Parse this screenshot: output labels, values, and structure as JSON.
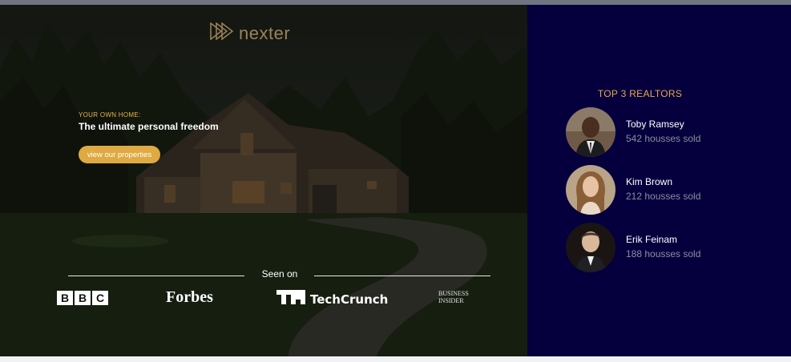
{
  "hero": {
    "logo": {
      "text": "nexter",
      "icon": "play-triangles-icon"
    },
    "tagline": "YOUR OWN HOME:",
    "headline": "The ultimate personal freedom",
    "cta_label": "view our properties"
  },
  "seen_on": {
    "label": "Seen on",
    "brands": {
      "bbc": [
        "B",
        "B",
        "C"
      ],
      "forbes": "Forbes",
      "techcrunch": "TechCrunch",
      "business_insider": "BUSINESS INSIDER"
    }
  },
  "realtors": {
    "title": "TOP 3 REALTORS",
    "items": [
      {
        "name": "Toby Ramsey",
        "sold": "542 housses sold"
      },
      {
        "name": "Kim Brown",
        "sold": "212 housses sold"
      },
      {
        "name": "Erik Feinam",
        "sold": "188 housses sold"
      }
    ]
  },
  "colors": {
    "accent": "#deaa41",
    "realtors_bg": "#05003d",
    "gold_text": "#e5a94a"
  }
}
